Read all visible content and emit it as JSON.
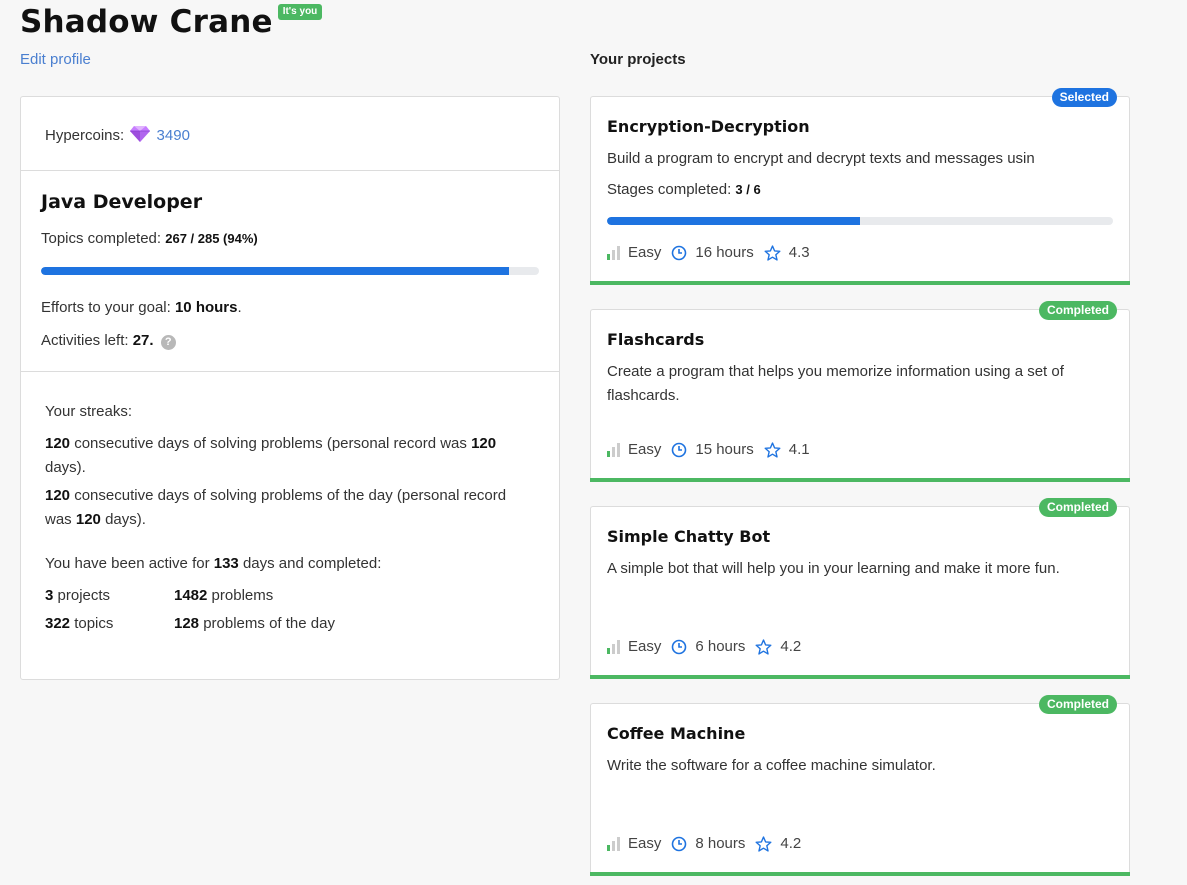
{
  "profile": {
    "name": "Shadow Crane",
    "its_you": "It's you",
    "edit_profile": "Edit profile",
    "hypercoins_label": "Hypercoins:",
    "hypercoins_value": "3490",
    "track_title": "Java Developer",
    "topics_label": "Topics completed:",
    "topics_value": "267 / 285 (94%)",
    "topics_progress": 0.94,
    "efforts_label": "Efforts to your goal:",
    "efforts_value": "10 hours",
    "activities_label": "Activities left:",
    "activities_value": "27.",
    "streaks_heading": "Your streaks:",
    "streak1_count": "120",
    "streak1_text": "consecutive days of solving problems (personal record was",
    "streak1_record": "120",
    "streak1_tail": "days).",
    "streak2_count": "120",
    "streak2_text": "consecutive days of solving problems of the day (personal record was",
    "streak2_record": "120",
    "streak2_tail": "days).",
    "active_prefix": "You have been active for",
    "active_days": "133",
    "active_suffix": "days and completed:",
    "stats": {
      "projects_count": "3",
      "projects_label": "projects",
      "problems_count": "1482",
      "problems_label": "problems",
      "topics_count": "322",
      "topics_label": "topics",
      "potd_count": "128",
      "potd_label": "problems of the day"
    }
  },
  "projects_heading": "Your projects",
  "colors": {
    "accent_blue": "#1e73e0",
    "success_green": "#4cb862",
    "link_blue": "#4a7fd0"
  },
  "projects": [
    {
      "badge": "Selected",
      "title": "Encryption-Decryption",
      "description": "Build a program to encrypt and decrypt texts and messages usin",
      "stages_label": "Stages completed:",
      "stages_value": "3 / 6",
      "stages_progress": 0.5,
      "difficulty": "Easy",
      "hours": "16 hours",
      "rating": "4.3"
    },
    {
      "badge": "Completed",
      "title": "Flashcards",
      "description": "Create a program that helps you memorize information using a set of flashcards.",
      "difficulty": "Easy",
      "hours": "15 hours",
      "rating": "4.1"
    },
    {
      "badge": "Completed",
      "title": "Simple Chatty Bot",
      "description": "A simple bot that will help you in your learning and make it more fun.",
      "difficulty": "Easy",
      "hours": "6 hours",
      "rating": "4.2"
    },
    {
      "badge": "Completed",
      "title": "Coffee Machine",
      "description": "Write the software for a coffee machine simulator.",
      "difficulty": "Easy",
      "hours": "8 hours",
      "rating": "4.2"
    }
  ]
}
